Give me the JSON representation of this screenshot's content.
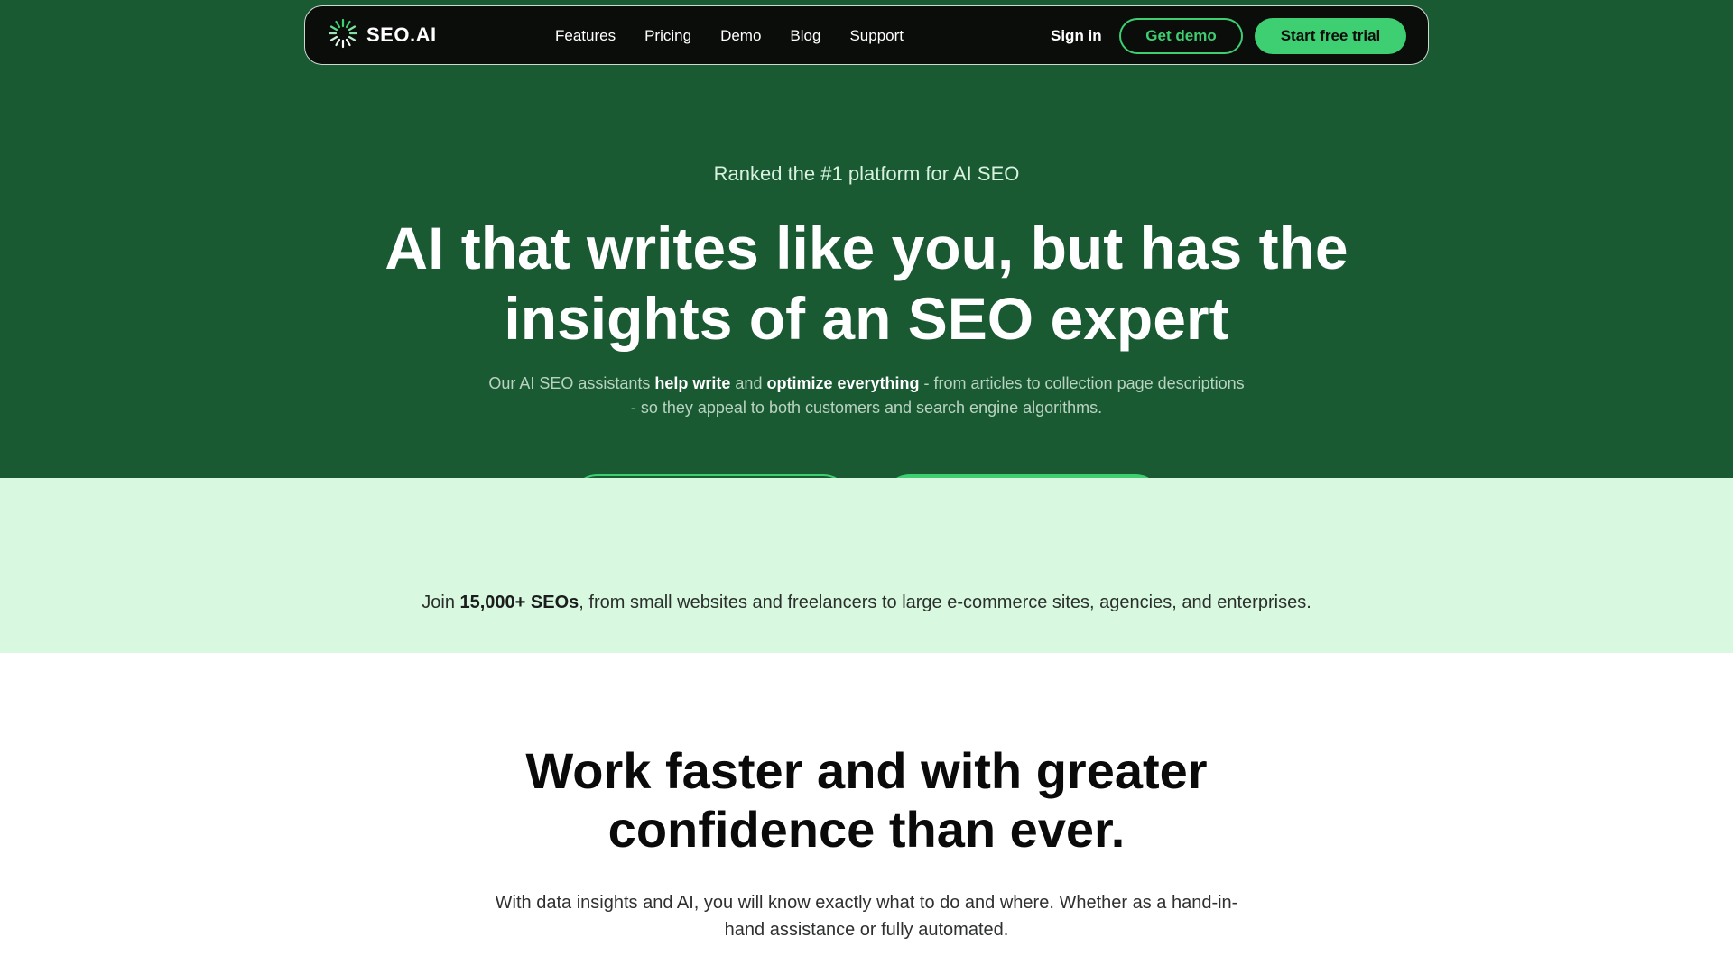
{
  "nav": {
    "logo_text": "SEO.AI",
    "links": [
      {
        "label": "Features"
      },
      {
        "label": "Pricing"
      },
      {
        "label": "Demo"
      },
      {
        "label": "Blog"
      },
      {
        "label": "Support"
      }
    ],
    "sign_in": "Sign in",
    "get_demo": "Get demo",
    "start_trial": "Start free trial"
  },
  "hero": {
    "eyebrow": "Ranked the #1 platform for AI SEO",
    "title": "AI that writes like you, but has the insights of an SEO expert",
    "sub_part1": "Our AI SEO assistants ",
    "sub_bold1": "help write",
    "sub_part2": " and ",
    "sub_bold2": "optimize everything",
    "sub_part3": " - from articles to collection page descriptions - so they appeal to both customers and search engine algorithms."
  },
  "band": {
    "join_part1": "Join ",
    "join_bold": "15,000+ SEOs",
    "join_part2": ", from small websites and freelancers to large e-commerce sites, agencies, and enterprises."
  },
  "section": {
    "title": "Work faster and with greater confidence than ever.",
    "text": "With data insights and AI, you will know exactly what to do and where. Whether as a hand-in-hand assistance or fully automated."
  },
  "colors": {
    "hero_bg": "#1a5a33",
    "band_bg": "#d8f8e0",
    "accent": "#3ecf72",
    "nav_bg": "#0b0d0b"
  },
  "icons": {
    "logo": "starburst-logo-icon"
  }
}
